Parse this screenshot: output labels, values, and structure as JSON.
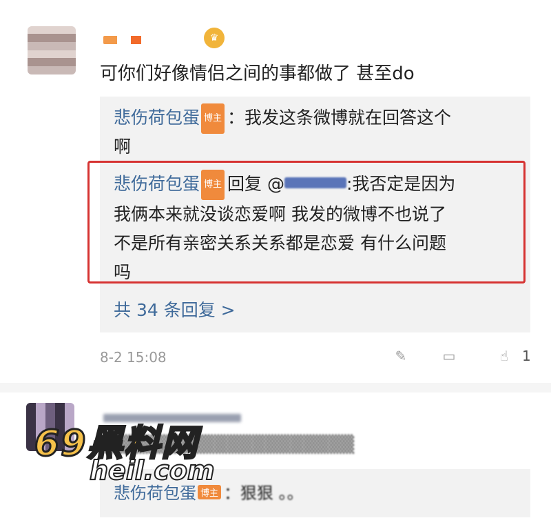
{
  "comment1": {
    "text": "可你们好像情侣之间的事都做了 甚至do",
    "timestamp": "8-2 15:08",
    "like_count": "1"
  },
  "replies": {
    "author": "悲伤荷包蛋",
    "badge": "博主",
    "reply1_line1": "：我发这条微博就在回答这个",
    "reply1_line2": "啊",
    "reply2_prefix": "回复 @",
    "reply2_line1_suffix": ":我否定是因为",
    "reply2_line2": "我俩本来就没谈恋爱啊 我发的微博不也说了",
    "reply2_line3": "不是所有亲密关系关系都是恋爱 有什么问题",
    "reply2_line4": "吗",
    "more": "共 34 条回复 >"
  },
  "comment2": {
    "reply_text": "：狠狠     。。"
  },
  "watermark": {
    "line1": "69黑料网",
    "line2": "heil.com"
  },
  "icons": {
    "share": "share-icon",
    "comment": "comment-icon",
    "like": "like-icon"
  }
}
